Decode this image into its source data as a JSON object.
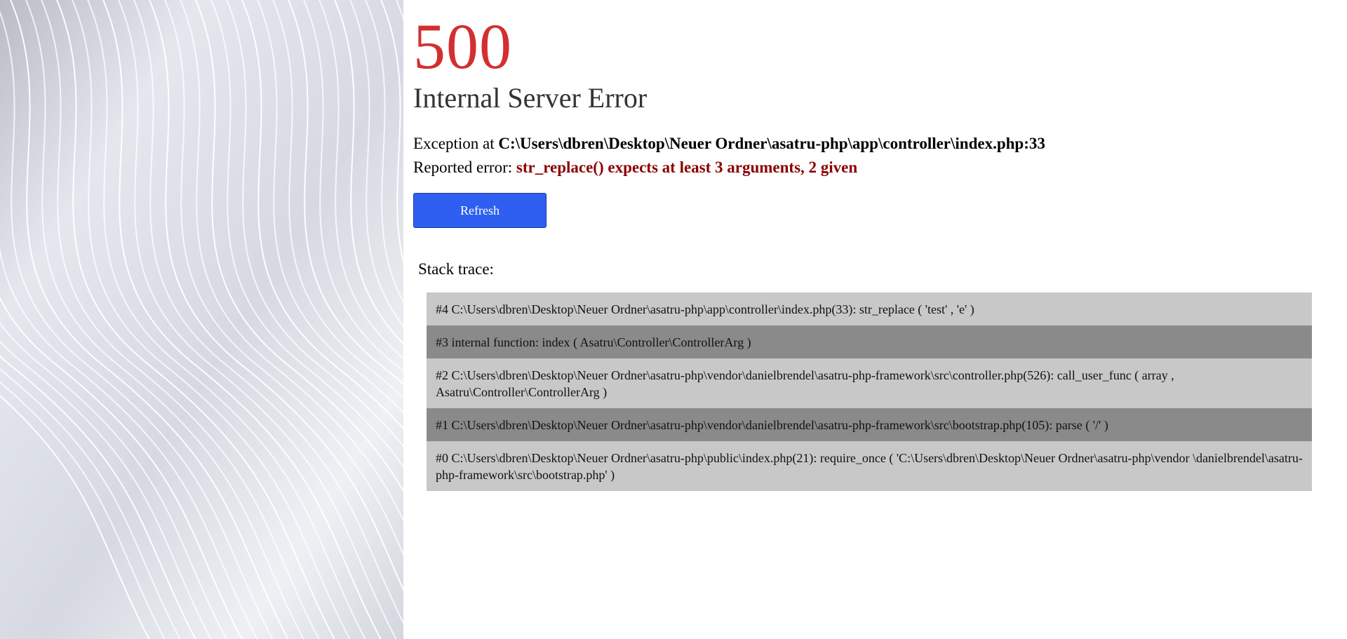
{
  "error": {
    "code": "500",
    "title": "Internal Server Error",
    "exception_prefix": "Exception at ",
    "exception_location": "C:\\Users\\dbren\\Desktop\\Neuer Ordner\\asatru-php\\app\\controller\\index.php:33",
    "reported_prefix": "Reported error: ",
    "reported_message": "str_replace() expects at least 3 arguments, 2 given"
  },
  "actions": {
    "refresh_label": "Refresh"
  },
  "stack": {
    "label": "Stack trace:",
    "frames": [
      "#4 C:\\Users\\dbren\\Desktop\\Neuer Ordner\\asatru-php\\app\\controller\\index.php(33): str_replace ( 'test' , 'e' )",
      "#3 internal function: index ( Asatru\\Controller\\ControllerArg )",
      "#2 C:\\Users\\dbren\\Desktop\\Neuer Ordner\\asatru-php\\vendor\\danielbrendel\\asatru-php-framework\\src\\controller.php(526): call_user_func ( array , Asatru\\Controller\\ControllerArg )",
      "#1 C:\\Users\\dbren\\Desktop\\Neuer Ordner\\asatru-php\\vendor\\danielbrendel\\asatru-php-framework\\src\\bootstrap.php(105): parse ( '/' )",
      "#0 C:\\Users\\dbren\\Desktop\\Neuer Ordner\\asatru-php\\public\\index.php(21): require_once ( 'C:\\Users\\dbren\\Desktop\\Neuer Ordner\\asatru-php\\vendor \\danielbrendel\\asatru-php-framework\\src\\bootstrap.php' )"
    ]
  },
  "colors": {
    "code": "#d32f2f",
    "reported_message": "#8b0000",
    "refresh_button": "#2f5ff0",
    "frame_light": "#c8c8c8",
    "frame_dark": "#8a8a8a"
  }
}
